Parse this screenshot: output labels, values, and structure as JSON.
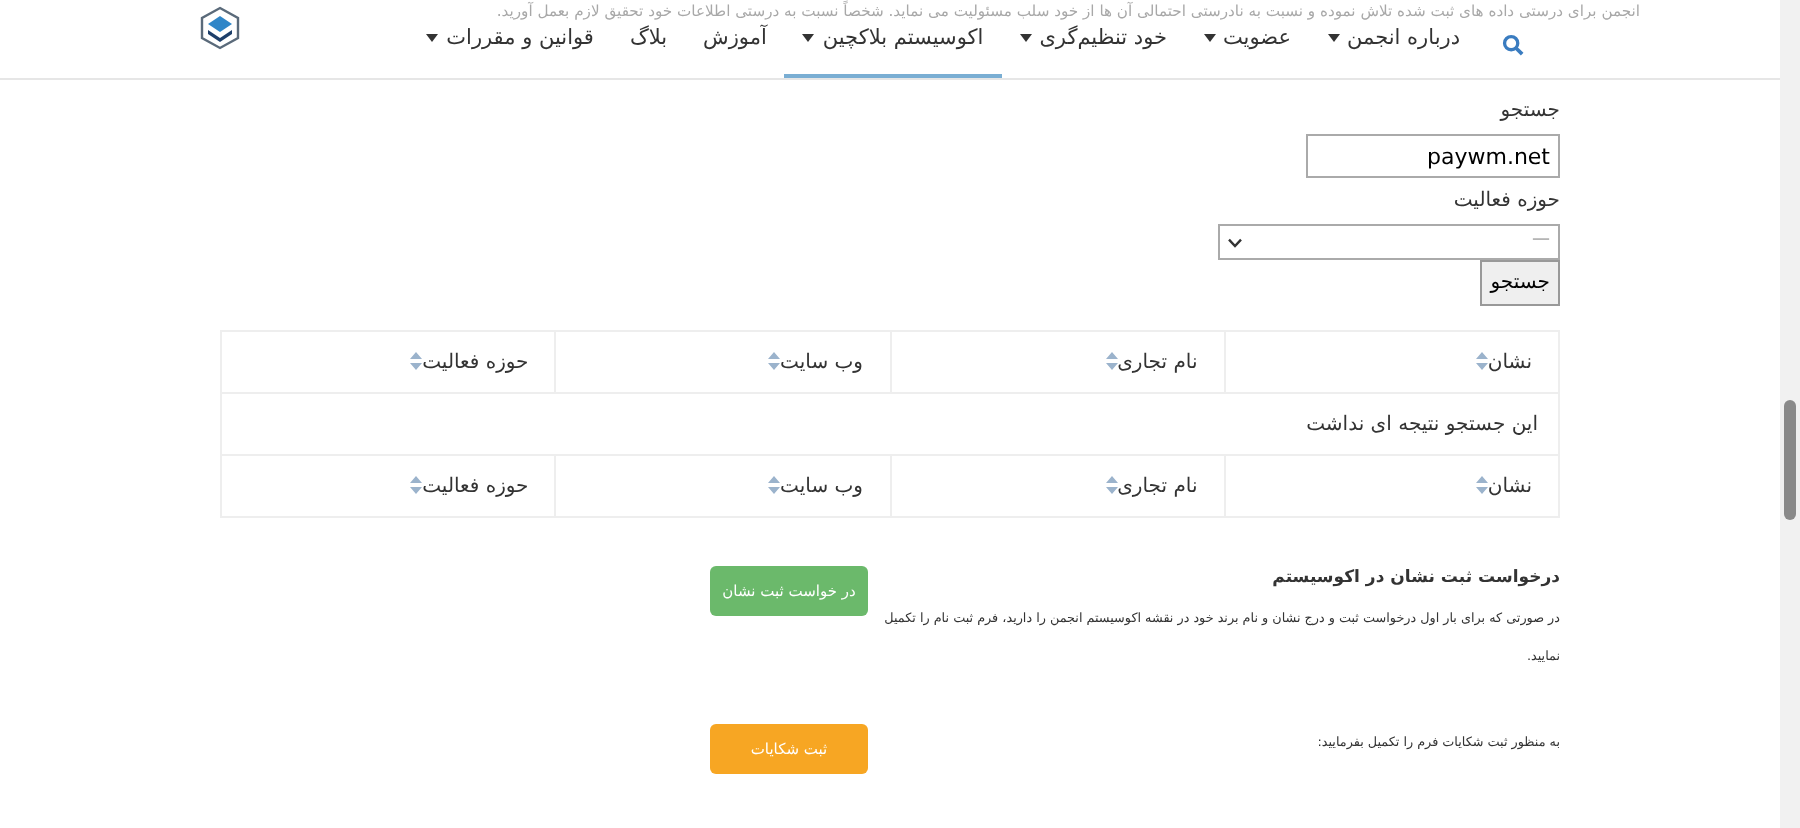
{
  "disclaimer": "انجمن برای درستی داده های ثبت شده تلاش نموده و نسبت به نادرستی احتمالی آن ها از خود سلب مسئولیت می نماید. شخصاً نسبت به درستی اطلاعات خود تحقیق لازم بعمل آورید.",
  "navbar": {
    "items": [
      {
        "label": "درباره انجمن",
        "dropdown": true,
        "selected": false
      },
      {
        "label": "عضویت",
        "dropdown": true,
        "selected": false
      },
      {
        "label": "خود تنظیم‌گری",
        "dropdown": true,
        "selected": false
      },
      {
        "label": "اکوسیستم بلاکچین",
        "dropdown": true,
        "selected": true
      },
      {
        "label": "آموزش",
        "dropdown": false,
        "selected": false
      },
      {
        "label": "بلاگ",
        "dropdown": false,
        "selected": false
      },
      {
        "label": "قوانین و مقررات",
        "dropdown": true,
        "selected": false
      }
    ]
  },
  "search_form": {
    "search_label": "جستجو",
    "search_value": "paywm.net",
    "category_label": "حوزه فعالیت",
    "category_value": "—",
    "button": "جستجو"
  },
  "table": {
    "columns": [
      "نشان",
      "نام تجاری",
      "وب سایت",
      "حوزه فعالیت"
    ],
    "empty_message": "این جستجو نتیجه ای نداشت",
    "footer_columns": [
      "نشان",
      "نام تجاری",
      "وب سایت",
      "حوزه فعالیت"
    ]
  },
  "sections": [
    {
      "title": "درخواست ثبت نشان در اکوسیستم",
      "text": "در صورتی که برای بار اول درخواست ثبت و درج نشان و نام برند خود در نقشه اکوسیستم انجمن را دارید، فرم ثبت نام را تکمیل نمایید.",
      "button": "در خواست ثبت نشان",
      "kind": "success"
    },
    {
      "text": "به منظور ثبت شکایات فرم را تکمیل بفرمایید:",
      "button": "ثبت شکایات",
      "kind": "warning"
    }
  ]
}
